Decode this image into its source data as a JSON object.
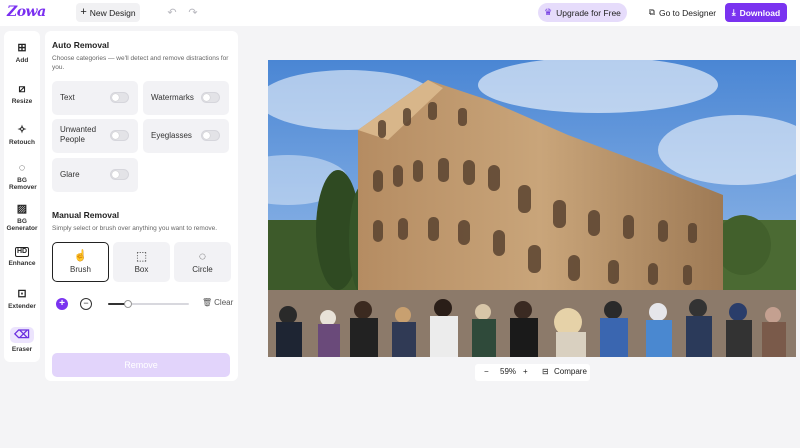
{
  "header": {
    "logo": "Zowa",
    "new_design": "New Design",
    "upgrade": "Upgrade for Free",
    "go_to_designer": "Go to Designer",
    "download": "Download"
  },
  "rail": [
    {
      "label": "Add",
      "icon": "add-icon"
    },
    {
      "label": "Resize",
      "icon": "resize-icon"
    },
    {
      "label": "Retouch",
      "icon": "retouch-icon"
    },
    {
      "label": "BG Remover",
      "icon": "bg-remover-icon"
    },
    {
      "label": "BG Generator",
      "icon": "bg-generator-icon"
    },
    {
      "label": "Enhance",
      "icon": "hd-enhance-icon"
    },
    {
      "label": "Extender",
      "icon": "extender-icon"
    },
    {
      "label": "Eraser",
      "icon": "eraser-icon",
      "active": true
    }
  ],
  "auto_removal": {
    "title": "Auto Removal",
    "description": "Choose categories — we'll detect and remove distractions for you.",
    "options": [
      {
        "label": "Text",
        "on": false
      },
      {
        "label": "Watermarks",
        "on": false
      },
      {
        "label": "Unwanted People",
        "on": false
      },
      {
        "label": "Eyeglasses",
        "on": false
      },
      {
        "label": "Glare",
        "on": false
      }
    ]
  },
  "manual_removal": {
    "title": "Manual Removal",
    "description": "Simply select or brush over anything you want to remove.",
    "tools": [
      {
        "label": "Brush",
        "selected": true
      },
      {
        "label": "Box",
        "selected": false
      },
      {
        "label": "Circle",
        "selected": false
      }
    ],
    "brush_size_fraction": 0.25,
    "clear": "Clear"
  },
  "remove_button": "Remove",
  "zoom": {
    "level": "59%",
    "compare": "Compare"
  },
  "colors": {
    "accent": "#7a33f0",
    "upgrade_bg": "#e6dcfb",
    "remove_disabled": "#e2d4fb"
  }
}
